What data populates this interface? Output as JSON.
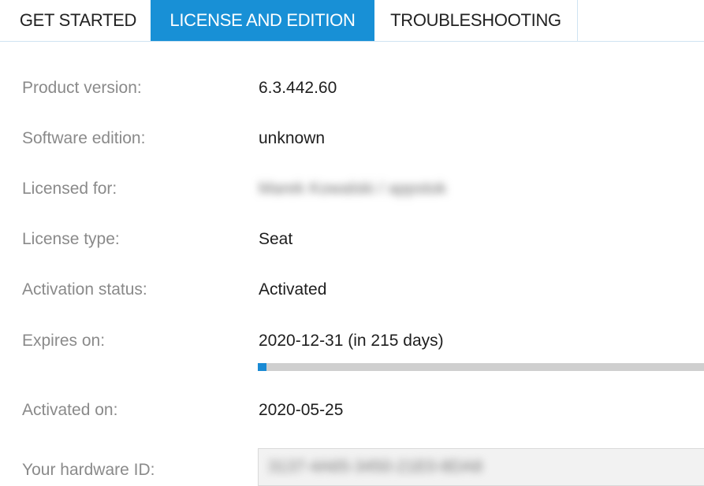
{
  "tabs": [
    {
      "label": "GET STARTED",
      "active": false
    },
    {
      "label": "LICENSE AND EDITION",
      "active": true
    },
    {
      "label": "TROUBLESHOOTING",
      "active": false
    }
  ],
  "info": {
    "product_version": {
      "label": "Product version:",
      "value": "6.3.442.60"
    },
    "software_edition": {
      "label": "Software edition:",
      "value": "unknown"
    },
    "licensed_for": {
      "label": "Licensed for:",
      "value": "Marek Kowalski / appstok"
    },
    "license_type": {
      "label": "License type:",
      "value": "Seat"
    },
    "activation_status": {
      "label": "Activation status:",
      "value": "Activated"
    },
    "expires_on": {
      "label": "Expires on:",
      "value": "2020-12-31 (in 215 days)",
      "progress_percent": 2
    },
    "activated_on": {
      "label": "Activated on:",
      "value": "2020-05-25"
    },
    "hardware_id": {
      "label": "Your hardware ID:",
      "value": "3137-4A65-3450-21E0-8DA8"
    }
  },
  "colors": {
    "accent": "#1890d6",
    "label_text": "#8a8a8a",
    "progress_track": "#cfcfcf",
    "progress_fill": "#1a8ad4"
  }
}
